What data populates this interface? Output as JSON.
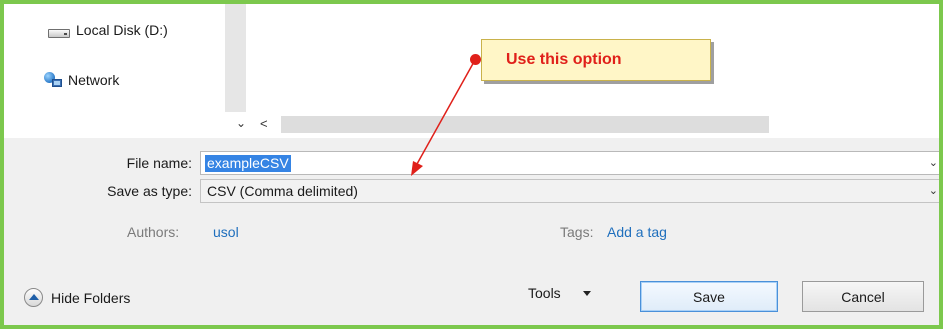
{
  "nav": {
    "items": [
      {
        "label": "Local Disk (D:)",
        "icon": "drive-icon"
      },
      {
        "label": "Network",
        "icon": "network-icon"
      }
    ]
  },
  "hscroll": {
    "left_glyph": "<",
    "expand_glyph": "⌄"
  },
  "form": {
    "file_name": {
      "label": "File name:",
      "value": "exampleCSV"
    },
    "save_as_type": {
      "label": "Save as type:",
      "value": "CSV (Comma delimited)"
    },
    "dropdown_glyph": "⌄"
  },
  "meta": {
    "authors_label": "Authors:",
    "authors_value": "usol",
    "tags_label": "Tags:",
    "tags_value": "Add a tag"
  },
  "footer": {
    "hide_folders": "Hide Folders",
    "tools": "Tools",
    "save": "Save",
    "cancel": "Cancel"
  },
  "annotation": {
    "text": "Use this option",
    "color": "#e0201a"
  },
  "colors": {
    "border": "#7cc84d",
    "selection": "#3584e4",
    "link": "#1f6fbd"
  }
}
